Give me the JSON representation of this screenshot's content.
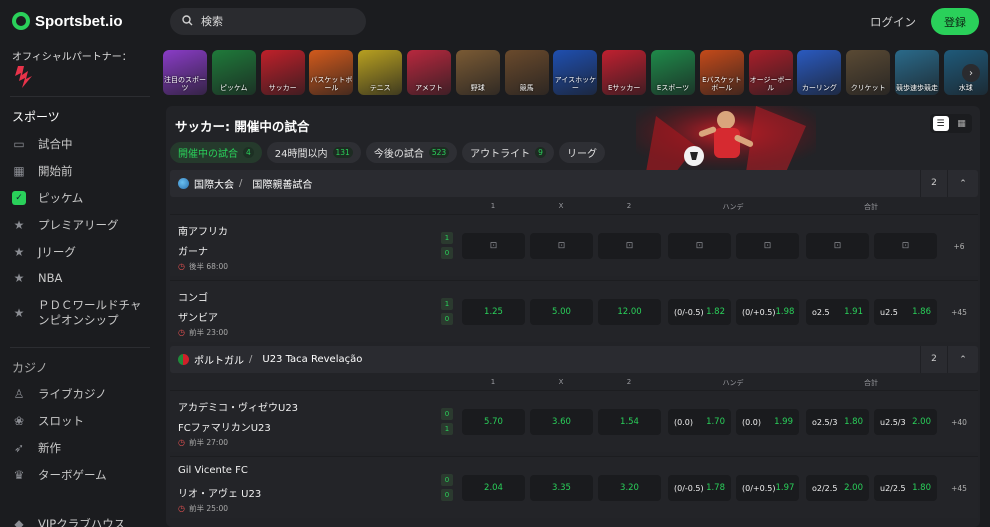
{
  "brand": {
    "name": "Sportsbet.io",
    "accent": "#2ad05a"
  },
  "partner": {
    "label": "オフィシャルパートナー：",
    "logo_text": "U"
  },
  "header": {
    "search_placeholder": "検索",
    "login": "ログイン",
    "register": "登録"
  },
  "sidebar": {
    "sports_title": "スポーツ",
    "sports": [
      {
        "label": "試合中",
        "icon": "monitor-icon"
      },
      {
        "label": "開始前",
        "icon": "calendar-icon"
      },
      {
        "label": "ピッケム",
        "icon": "pickem-icon"
      },
      {
        "label": "プレミアリーグ",
        "icon": "star-icon"
      },
      {
        "label": "Jリーグ",
        "icon": "star-icon"
      },
      {
        "label": "NBA",
        "icon": "star-icon"
      },
      {
        "label": "ＰＤＣワールドチャンピオンシップ",
        "icon": "star-icon"
      }
    ],
    "casino_title": "カジノ",
    "casino": [
      {
        "label": "ライブカジノ",
        "icon": "dealer-icon"
      },
      {
        "label": "スロット",
        "icon": "cherries-icon"
      },
      {
        "label": "新作",
        "icon": "rocket-icon"
      },
      {
        "label": "ターボゲーム",
        "icon": "crown-icon"
      },
      {
        "label": "VIPクラブハウス",
        "icon": "vip-icon"
      }
    ]
  },
  "sport_tiles": [
    {
      "label": "注目のスポーツ",
      "color": "#8a3cc7"
    },
    {
      "label": "ピッケム",
      "color": "#1f7a3a"
    },
    {
      "label": "サッカー",
      "color": "#c0202a"
    },
    {
      "label": "バスケットボール",
      "color": "#d25a1c"
    },
    {
      "label": "テニス",
      "color": "#b8a020"
    },
    {
      "label": "アメフト",
      "color": "#b8283e"
    },
    {
      "label": "野球",
      "color": "#7a5a34"
    },
    {
      "label": "競馬",
      "color": "#6a4a2c"
    },
    {
      "label": "アイスホッケー",
      "color": "#1f4fb0"
    },
    {
      "label": "Eサッカー",
      "color": "#c02030"
    },
    {
      "label": "Eスポーツ",
      "color": "#1f8a4a"
    },
    {
      "label": "Eバスケットボール",
      "color": "#c44a1a"
    },
    {
      "label": "オージーボール",
      "color": "#a81f2a"
    },
    {
      "label": "カーリング",
      "color": "#2a5ac0"
    },
    {
      "label": "クリケット",
      "color": "#5a4a34"
    },
    {
      "label": "競歩速歩競走",
      "color": "#2a6a8a"
    },
    {
      "label": "水球",
      "color": "#1f5a7a"
    }
  ],
  "main": {
    "title": "サッカー: 開催中の試合",
    "filters": [
      {
        "label": "開催中の試合",
        "count": "4",
        "active": true
      },
      {
        "label": "24時間以内",
        "count": "131"
      },
      {
        "label": "今後の試合",
        "count": "523"
      },
      {
        "label": "アウトライト",
        "count": "9"
      },
      {
        "label": "リーグ",
        "count": ""
      }
    ],
    "col_labels": {
      "one": "1",
      "x": "X",
      "two": "2",
      "handicap": "ハンデ",
      "total": "合計"
    },
    "groups": [
      {
        "region": "国際大会",
        "league": "国際親善試合",
        "count": "2",
        "flag_color": "#3a8ad0",
        "matches": [
          {
            "home": "南アフリカ",
            "away": "ガーナ",
            "time": "後半 68:00",
            "score_home": "1",
            "score_away": "0",
            "locked": true,
            "odds": [],
            "more": "+6"
          },
          {
            "home": "コンゴ",
            "away": "ザンビア",
            "time": "前半 23:00",
            "score_home": "1",
            "score_away": "0",
            "locked": false,
            "odds": [
              {
                "line": "",
                "price": "1.25"
              },
              {
                "line": "",
                "price": "5.00"
              },
              {
                "line": "",
                "price": "12.00"
              },
              {
                "line": "(0/-0.5)",
                "price": "1.82"
              },
              {
                "line": "(0/+0.5)",
                "price": "1.98"
              },
              {
                "line": "o2.5",
                "price": "1.91"
              },
              {
                "line": "u2.5",
                "price": "1.86"
              }
            ],
            "more": "+45"
          }
        ]
      },
      {
        "region": "ポルトガル",
        "league": "U23 Taca Revelação",
        "count": "2",
        "flag_color": "#c0202a",
        "matches": [
          {
            "home": "アカデミコ・ヴィゼウU23",
            "away": "FCファマリカンU23",
            "time": "前半 27:00",
            "score_home": "0",
            "score_away": "1",
            "locked": false,
            "odds": [
              {
                "line": "",
                "price": "5.70"
              },
              {
                "line": "",
                "price": "3.60"
              },
              {
                "line": "",
                "price": "1.54"
              },
              {
                "line": "(0.0)",
                "price": "1.70"
              },
              {
                "line": "(0.0)",
                "price": "1.99"
              },
              {
                "line": "o2.5/3",
                "price": "1.80"
              },
              {
                "line": "u2.5/3",
                "price": "2.00"
              }
            ],
            "more": "+40"
          },
          {
            "home": "Gil Vicente FC",
            "away": "リオ・アヴェ U23",
            "time": "前半 25:00",
            "score_home": "0",
            "score_away": "0",
            "locked": false,
            "odds": [
              {
                "line": "",
                "price": "2.04"
              },
              {
                "line": "",
                "price": "3.35"
              },
              {
                "line": "",
                "price": "3.20"
              },
              {
                "line": "(0/-0.5)",
                "price": "1.78"
              },
              {
                "line": "(0/+0.5)",
                "price": "1.97"
              },
              {
                "line": "o2/2.5",
                "price": "2.00"
              },
              {
                "line": "u2/2.5",
                "price": "1.80"
              }
            ],
            "more": "+45"
          }
        ]
      }
    ]
  }
}
